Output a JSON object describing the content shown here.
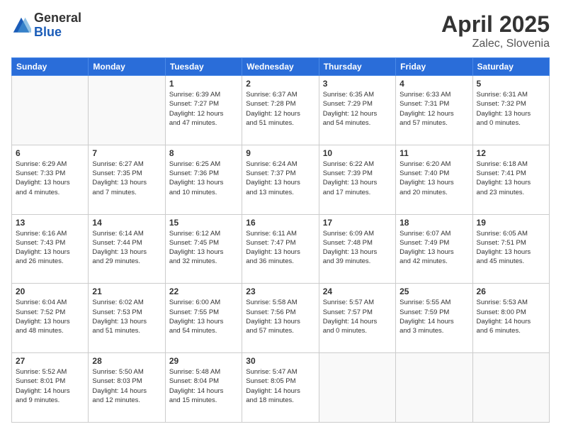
{
  "header": {
    "logo_general": "General",
    "logo_blue": "Blue",
    "title": "April 2025",
    "subtitle": "Zalec, Slovenia"
  },
  "calendar": {
    "headers": [
      "Sunday",
      "Monday",
      "Tuesday",
      "Wednesday",
      "Thursday",
      "Friday",
      "Saturday"
    ],
    "rows": [
      [
        {
          "day": "",
          "detail": ""
        },
        {
          "day": "",
          "detail": ""
        },
        {
          "day": "1",
          "detail": "Sunrise: 6:39 AM\nSunset: 7:27 PM\nDaylight: 12 hours\nand 47 minutes."
        },
        {
          "day": "2",
          "detail": "Sunrise: 6:37 AM\nSunset: 7:28 PM\nDaylight: 12 hours\nand 51 minutes."
        },
        {
          "day": "3",
          "detail": "Sunrise: 6:35 AM\nSunset: 7:29 PM\nDaylight: 12 hours\nand 54 minutes."
        },
        {
          "day": "4",
          "detail": "Sunrise: 6:33 AM\nSunset: 7:31 PM\nDaylight: 12 hours\nand 57 minutes."
        },
        {
          "day": "5",
          "detail": "Sunrise: 6:31 AM\nSunset: 7:32 PM\nDaylight: 13 hours\nand 0 minutes."
        }
      ],
      [
        {
          "day": "6",
          "detail": "Sunrise: 6:29 AM\nSunset: 7:33 PM\nDaylight: 13 hours\nand 4 minutes."
        },
        {
          "day": "7",
          "detail": "Sunrise: 6:27 AM\nSunset: 7:35 PM\nDaylight: 13 hours\nand 7 minutes."
        },
        {
          "day": "8",
          "detail": "Sunrise: 6:25 AM\nSunset: 7:36 PM\nDaylight: 13 hours\nand 10 minutes."
        },
        {
          "day": "9",
          "detail": "Sunrise: 6:24 AM\nSunset: 7:37 PM\nDaylight: 13 hours\nand 13 minutes."
        },
        {
          "day": "10",
          "detail": "Sunrise: 6:22 AM\nSunset: 7:39 PM\nDaylight: 13 hours\nand 17 minutes."
        },
        {
          "day": "11",
          "detail": "Sunrise: 6:20 AM\nSunset: 7:40 PM\nDaylight: 13 hours\nand 20 minutes."
        },
        {
          "day": "12",
          "detail": "Sunrise: 6:18 AM\nSunset: 7:41 PM\nDaylight: 13 hours\nand 23 minutes."
        }
      ],
      [
        {
          "day": "13",
          "detail": "Sunrise: 6:16 AM\nSunset: 7:43 PM\nDaylight: 13 hours\nand 26 minutes."
        },
        {
          "day": "14",
          "detail": "Sunrise: 6:14 AM\nSunset: 7:44 PM\nDaylight: 13 hours\nand 29 minutes."
        },
        {
          "day": "15",
          "detail": "Sunrise: 6:12 AM\nSunset: 7:45 PM\nDaylight: 13 hours\nand 32 minutes."
        },
        {
          "day": "16",
          "detail": "Sunrise: 6:11 AM\nSunset: 7:47 PM\nDaylight: 13 hours\nand 36 minutes."
        },
        {
          "day": "17",
          "detail": "Sunrise: 6:09 AM\nSunset: 7:48 PM\nDaylight: 13 hours\nand 39 minutes."
        },
        {
          "day": "18",
          "detail": "Sunrise: 6:07 AM\nSunset: 7:49 PM\nDaylight: 13 hours\nand 42 minutes."
        },
        {
          "day": "19",
          "detail": "Sunrise: 6:05 AM\nSunset: 7:51 PM\nDaylight: 13 hours\nand 45 minutes."
        }
      ],
      [
        {
          "day": "20",
          "detail": "Sunrise: 6:04 AM\nSunset: 7:52 PM\nDaylight: 13 hours\nand 48 minutes."
        },
        {
          "day": "21",
          "detail": "Sunrise: 6:02 AM\nSunset: 7:53 PM\nDaylight: 13 hours\nand 51 minutes."
        },
        {
          "day": "22",
          "detail": "Sunrise: 6:00 AM\nSunset: 7:55 PM\nDaylight: 13 hours\nand 54 minutes."
        },
        {
          "day": "23",
          "detail": "Sunrise: 5:58 AM\nSunset: 7:56 PM\nDaylight: 13 hours\nand 57 minutes."
        },
        {
          "day": "24",
          "detail": "Sunrise: 5:57 AM\nSunset: 7:57 PM\nDaylight: 14 hours\nand 0 minutes."
        },
        {
          "day": "25",
          "detail": "Sunrise: 5:55 AM\nSunset: 7:59 PM\nDaylight: 14 hours\nand 3 minutes."
        },
        {
          "day": "26",
          "detail": "Sunrise: 5:53 AM\nSunset: 8:00 PM\nDaylight: 14 hours\nand 6 minutes."
        }
      ],
      [
        {
          "day": "27",
          "detail": "Sunrise: 5:52 AM\nSunset: 8:01 PM\nDaylight: 14 hours\nand 9 minutes."
        },
        {
          "day": "28",
          "detail": "Sunrise: 5:50 AM\nSunset: 8:03 PM\nDaylight: 14 hours\nand 12 minutes."
        },
        {
          "day": "29",
          "detail": "Sunrise: 5:48 AM\nSunset: 8:04 PM\nDaylight: 14 hours\nand 15 minutes."
        },
        {
          "day": "30",
          "detail": "Sunrise: 5:47 AM\nSunset: 8:05 PM\nDaylight: 14 hours\nand 18 minutes."
        },
        {
          "day": "",
          "detail": ""
        },
        {
          "day": "",
          "detail": ""
        },
        {
          "day": "",
          "detail": ""
        }
      ]
    ]
  }
}
